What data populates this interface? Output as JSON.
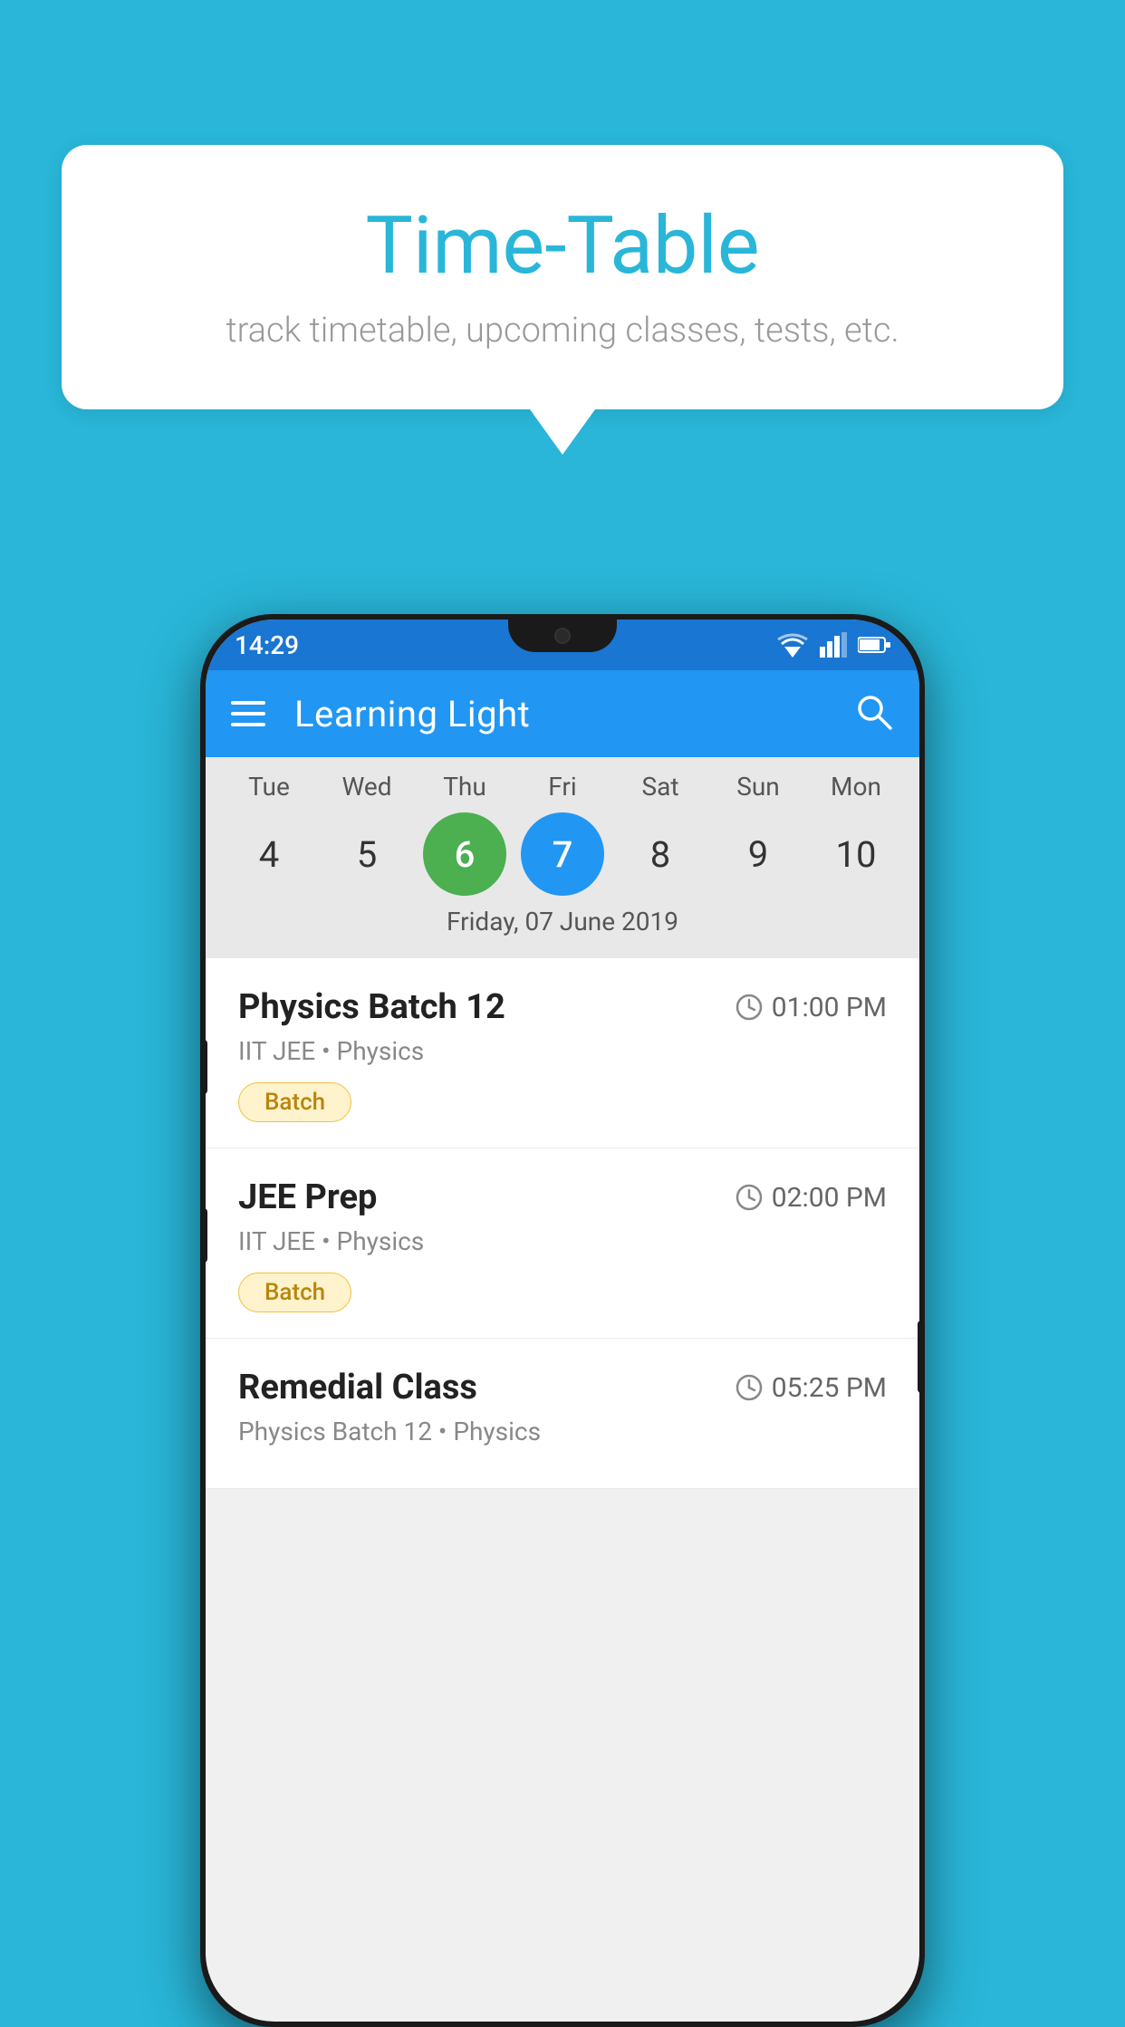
{
  "background_color": "#29B6D8",
  "bubble": {
    "title": "Time-Table",
    "subtitle": "track timetable, upcoming classes, tests, etc."
  },
  "phone": {
    "status_bar": {
      "time": "14:29"
    },
    "app_bar": {
      "title": "Learning Light"
    },
    "calendar": {
      "days": [
        {
          "name": "Tue",
          "number": "4",
          "state": "normal"
        },
        {
          "name": "Wed",
          "number": "5",
          "state": "normal"
        },
        {
          "name": "Thu",
          "number": "6",
          "state": "today"
        },
        {
          "name": "Fri",
          "number": "7",
          "state": "selected"
        },
        {
          "name": "Sat",
          "number": "8",
          "state": "normal"
        },
        {
          "name": "Sun",
          "number": "9",
          "state": "normal"
        },
        {
          "name": "Mon",
          "number": "10",
          "state": "normal"
        }
      ],
      "selected_date_label": "Friday, 07 June 2019"
    },
    "events": [
      {
        "title": "Physics Batch 12",
        "time": "01:00 PM",
        "subtitle": "IIT JEE • Physics",
        "badge": "Batch"
      },
      {
        "title": "JEE Prep",
        "time": "02:00 PM",
        "subtitle": "IIT JEE • Physics",
        "badge": "Batch"
      },
      {
        "title": "Remedial Class",
        "time": "05:25 PM",
        "subtitle": "Physics Batch 12 • Physics",
        "badge": null
      }
    ]
  }
}
